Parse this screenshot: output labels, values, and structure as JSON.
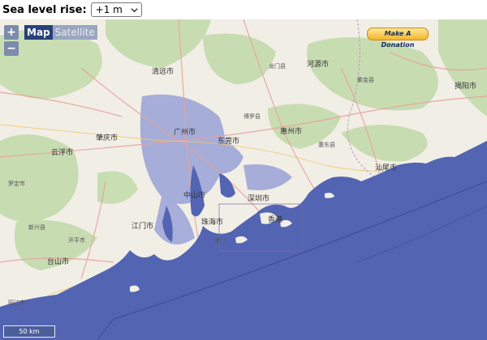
{
  "controls": {
    "sea_level_label": "Sea level rise:",
    "sea_level_value": "+1 m"
  },
  "map_type": {
    "map": "Map",
    "satellite": "Satellite"
  },
  "zoom": {
    "in": "+",
    "out": "−"
  },
  "donate_label": "Make A Donation",
  "scale_label": "50 km",
  "colors": {
    "water": "#5364b3",
    "land": "#f1eee6",
    "forest": "#c6dcb0",
    "urban": "#9aa2d6",
    "road": "#e9a19c"
  },
  "places": {
    "heyuan": "河源市",
    "qingyuan": "清远市",
    "zhaoqing": "肇庆市",
    "yunfu": "云浮市",
    "guangzhou": "广州市",
    "dongguan": "东莞市",
    "huizhou": "惠州市",
    "shenzhen": "深圳市",
    "zhongshan": "中山市",
    "zhuhai": "珠海市",
    "jiangmen": "江门市",
    "hongkong": "香港",
    "macau": "澳门",
    "xinxing": "新兴县",
    "longmen": "龙门县",
    "zijin": "紫金县",
    "boluo": "博罗县",
    "huidong": "惠东县",
    "shanwei": "汕尾市",
    "kaiping": "开平市",
    "taishan": "台山市",
    "jieyang": "揭阳市",
    "luoding": "罗定市",
    "yangjiang": "阳江市"
  }
}
